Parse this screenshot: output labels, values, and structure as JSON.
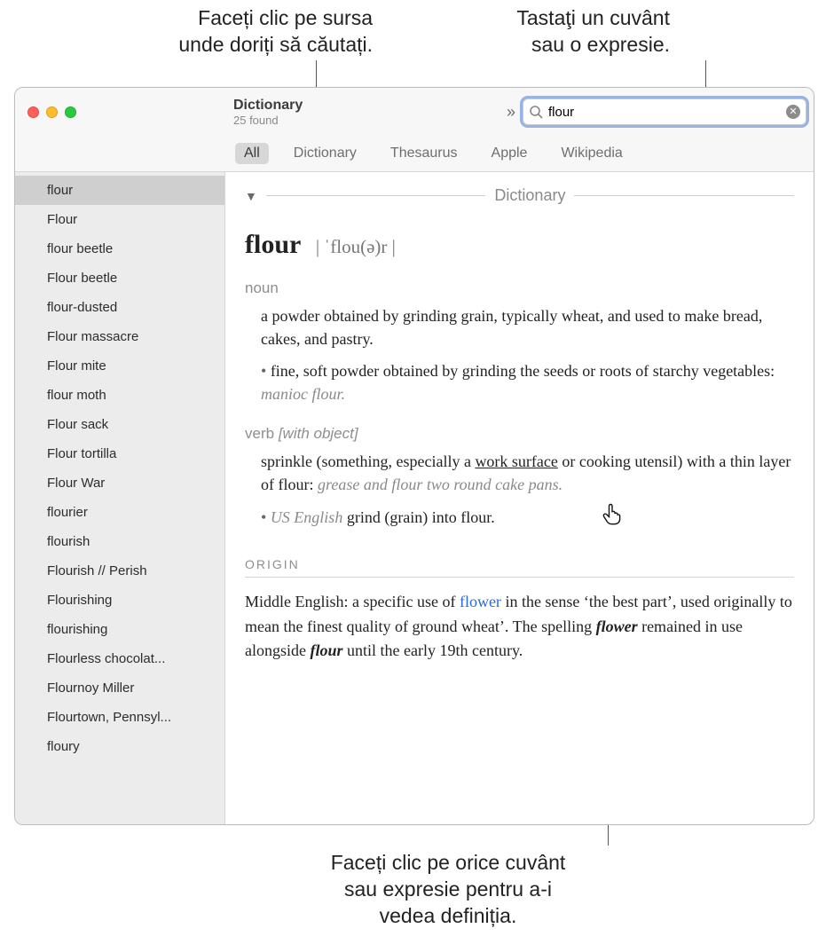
{
  "callouts": {
    "source": "Faceți clic pe sursa\nunde doriți să căutați.",
    "search": "Tastaţi un cuvânt\nsau o expresie.",
    "define": "Faceți clic pe orice cuvânt\nsau expresie pentru a-i\nvedea definiția."
  },
  "toolbar": {
    "title": "Dictionary",
    "count": "25 found",
    "overflow_glyph": "»",
    "clear_glyph": "✕"
  },
  "search": {
    "value": "flour"
  },
  "tabs": [
    {
      "label": "All",
      "active": true
    },
    {
      "label": "Dictionary",
      "active": false
    },
    {
      "label": "Thesaurus",
      "active": false
    },
    {
      "label": "Apple",
      "active": false
    },
    {
      "label": "Wikipedia",
      "active": false
    }
  ],
  "sidebar": {
    "items": [
      "flour",
      "Flour",
      "flour beetle",
      "Flour beetle",
      "flour-dusted",
      "Flour massacre",
      "Flour mite",
      "flour moth",
      "Flour sack",
      "Flour tortilla",
      "Flour War",
      "flourier",
      "flourish",
      "Flourish // Perish",
      "Flourishing",
      "flourishing",
      "Flourless chocolat...",
      "Flournoy Miller",
      "Flourtown, Pennsyl...",
      "floury"
    ],
    "selected_index": 0
  },
  "entry": {
    "section_label": "Dictionary",
    "headword": "flour",
    "pronunciation": "| ˈflou(ə)r |",
    "noun_label": "noun",
    "noun_def": "a powder obtained by grinding grain, typically wheat, and used to make bread, cakes, and pastry",
    "noun_sub_pre": "fine, soft powder obtained by grinding the seeds or roots of starchy vegetables",
    "noun_sub_example": "manioc flour.",
    "verb_label": "verb",
    "verb_qualifier": "[with object]",
    "verb_def_pre": "sprinkle (something, especially a ",
    "verb_def_link": "work surface",
    "verb_def_post": " or cooking utensil) with a thin layer of flour",
    "verb_def_example": "grease and flour two round cake pans.",
    "verb_sub_region": "US English",
    "verb_sub_def": "grind (grain) into flour",
    "origin_label": "ORIGIN",
    "origin_pre": "Middle English: a specific use of ",
    "origin_link": "flower",
    "origin_mid1": " in the sense ‘the best part’, used originally to mean the finest quality of ground wheat’. The spelling ",
    "origin_bold1": "flower",
    "origin_mid2": " remained in use alongside ",
    "origin_bold2": "flour",
    "origin_post": " until the early 19th century."
  }
}
